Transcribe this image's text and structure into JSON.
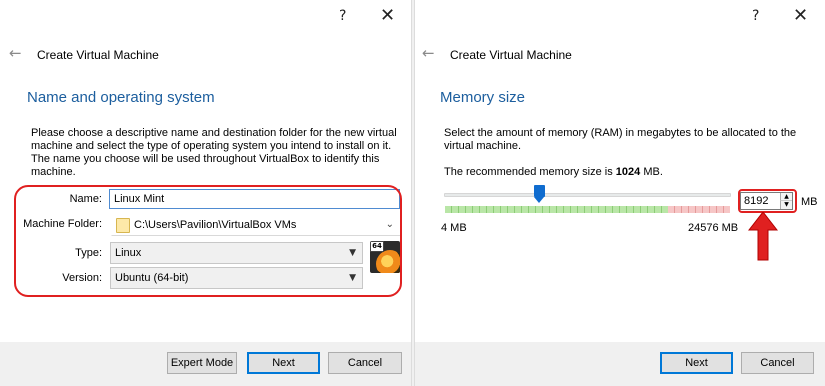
{
  "left": {
    "help_label": "?",
    "close_label": "✕",
    "back_label": "←",
    "wizard_title": "Create Virtual Machine",
    "section_title": "Name and operating system",
    "description": "Please choose a descriptive name and destination folder for the new virtual machine and select the type of operating system you intend to install on it. The name you choose will be used throughout VirtualBox to identify this machine.",
    "name_label": "Name:",
    "name_value": "Linux Mint",
    "folder_label": "Machine Folder:",
    "folder_value": "C:\\Users\\Pavilion\\VirtualBox VMs",
    "type_label": "Type:",
    "type_value": "Linux",
    "version_label": "Version:",
    "version_value": "Ubuntu (64-bit)",
    "os_badge": "64",
    "buttons": {
      "expert": "Expert Mode",
      "next": "Next",
      "cancel": "Cancel"
    },
    "icons": [
      "back-arrow-icon",
      "folder-icon",
      "ubuntu-os-icon",
      "dropdown-arrow-icon"
    ]
  },
  "right": {
    "help_label": "?",
    "close_label": "✕",
    "back_label": "←",
    "wizard_title": "Create Virtual Machine",
    "section_title": "Memory size",
    "description": "Select the amount of memory (RAM) in megabytes to be allocated to the virtual machine.",
    "recommended_prefix": "The recommended memory size is ",
    "recommended_value": "1024",
    "recommended_suffix": " MB.",
    "slider_min_label": "4 MB",
    "slider_max_label": "24576 MB",
    "slider_min": 4,
    "slider_max": 24576,
    "memory_value": "8192",
    "unit_label": "MB",
    "buttons": {
      "next": "Next",
      "cancel": "Cancel"
    }
  },
  "colors": {
    "section_title": "#1c5e9e",
    "highlight": "#e02020",
    "slider_thumb": "#0f6ccf",
    "default_button_border": "#0078d7"
  }
}
